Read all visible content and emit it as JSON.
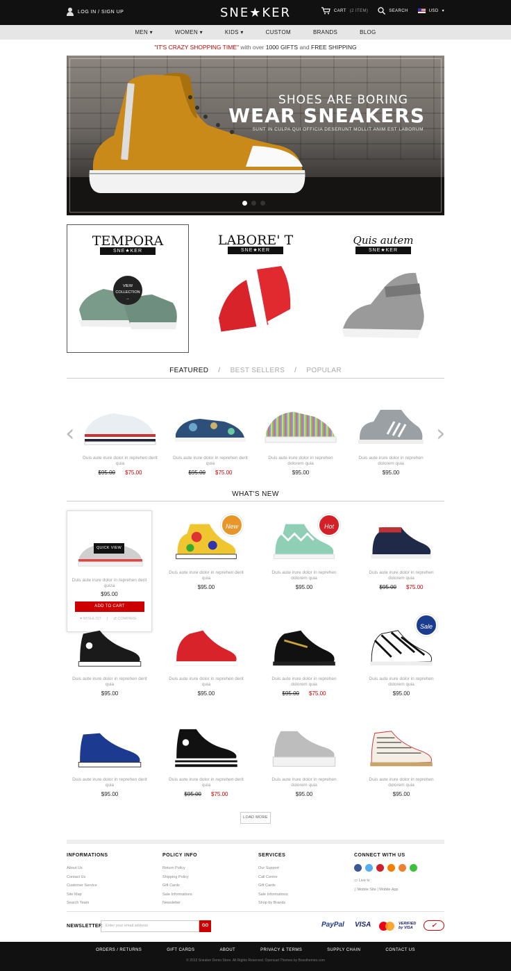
{
  "header": {
    "login": "LOG IN / SIGN UP",
    "logo": "SNE★KER",
    "cart": "CART",
    "cart_count": "(2 ITEM)",
    "search": "SEARCH",
    "currency": "USD"
  },
  "nav": [
    "MEN",
    "WOMEN",
    "KIDS",
    "CUSTOM",
    "BRANDS",
    "BLOG"
  ],
  "promo": {
    "part1": "\"IT'S CRAZY SHOPPING TIME\"",
    "part2": "with over",
    "part3": "1000 GIFTS",
    "part4": "and",
    "part5": "FREE SHIPPING"
  },
  "hero": {
    "line1": "SHOES ARE BORING",
    "line2": "WEAR SNEAKERS",
    "line3": "SUNT IN CULPA QUI OFFICIA DESERUNT MOLLIT ANIM EST LABORUM"
  },
  "categories": [
    {
      "title": "TEMPORA",
      "tag": "SNE★KER",
      "button": "VIEW COLLECTION"
    },
    {
      "title": "LABORE' T",
      "tag": "SNE★KER"
    },
    {
      "title": "Quis autem",
      "tag": "SNE★KER"
    }
  ],
  "tabs": {
    "featured": "FEATURED",
    "bestsellers": "BEST SELLERS",
    "popular": "POPULAR",
    "sep": "/"
  },
  "featured": [
    {
      "desc": "Duis aute irure dolor in reprehen derit quia",
      "old": "$95.00",
      "price": "$75.00"
    },
    {
      "desc": "Duis aute irure dolor in reprehen derit quia",
      "old": "$95.00",
      "price": "$75.00"
    },
    {
      "desc": "Duis aute irure dolor in reprehen dolorem quia",
      "price": "$95.00"
    },
    {
      "desc": "Duis aute irure dolor in reprehen dolorem quia",
      "price": "$95.00"
    }
  ],
  "whatsnew": "WHAT'S NEW",
  "card": {
    "quickview": "QUICK VIEW",
    "addcart": "ADD TO CART",
    "wishlist": "WISHLIST",
    "compare": "COMPARE"
  },
  "products": [
    {
      "desc": "Duis aute irure dolor in reprehen derit quiza",
      "price": "$95.00"
    },
    {
      "desc": "Duis aute irure dolor in reprehen derit quia",
      "price": "$95.00",
      "badge": "New"
    },
    {
      "desc": "Duis aute irure dolor in reprehen dolorem quia",
      "price": "$95.00",
      "badge": "Hot"
    },
    {
      "desc": "Duis aute irure dolor in reprehen dolorem quia",
      "old": "$95.00",
      "price": "$75.00"
    },
    {
      "desc": "Duis aute irure dolor in reprehen derit quia",
      "price": "$95.00"
    },
    {
      "desc": "Duis aute irure dolor in reprehen derit quia",
      "price": "$95.00"
    },
    {
      "desc": "Duis aute irure dolor in reprehen dolorem quia",
      "old": "$95.00",
      "price": "$75.00"
    },
    {
      "desc": "Duis aute irure dolor in reprehen dolorem quia",
      "price": "$95.00",
      "badge": "Sale"
    },
    {
      "desc": "Duis aute irure dolor in reprehen derit quia",
      "price": "$95.00"
    },
    {
      "desc": "Duis aute irure dolor in reprehen derit quia",
      "old": "$95.00",
      "price": "$75.00"
    },
    {
      "desc": "Duis aute irure dolor in reprehen dolorem quia",
      "price": "$95.00"
    },
    {
      "desc": "Duis aute irure dolor in reprehen dolorem quia",
      "price": "$95.00"
    }
  ],
  "loadmore": "LOAD MORE",
  "footer": {
    "info": {
      "title": "INFORMATIONS",
      "links": [
        "About Us",
        "Contact Us",
        "Customer Service",
        "Site Map",
        "Search Team"
      ]
    },
    "policy": {
      "title": "POLICY INFO",
      "links": [
        "Return Policy",
        "Shipping Policy",
        "Gift Cards",
        "Sale Informations",
        "Newsletter"
      ]
    },
    "services": {
      "title": "SERVICES",
      "links": [
        "Our Support",
        "Call Centre",
        "Gift Cards",
        "Sale Informations",
        "Shop by Brands"
      ]
    },
    "connect": {
      "title": "CONNECT WITH US",
      "live": "Live tv",
      "mobile": "Mobile Site",
      "app": "Mobile App",
      "sep": "|"
    },
    "newsletter_label": "NEWSLETTER",
    "newsletter_placeholder": "Enter your email address",
    "go": "GO",
    "payments": [
      "PayPal",
      "VISA",
      "MasterCard",
      "VERIFIED by VISA",
      "✓"
    ]
  },
  "bottom": {
    "links": [
      "ORDERS / RETURNS",
      "GIFT CARDS",
      "ABOUT",
      "PRIVACY & TERMS",
      "SUPPLY CHAIN",
      "CONTACT US"
    ],
    "copyright": "© 2013 Sneaker Demo Store. All Rights Reserved. Opencart Themes by Bossthemes.com"
  },
  "colors": {
    "accent": "#cc0000",
    "dark": "#111111",
    "nav_bg": "#e6e6e6"
  }
}
